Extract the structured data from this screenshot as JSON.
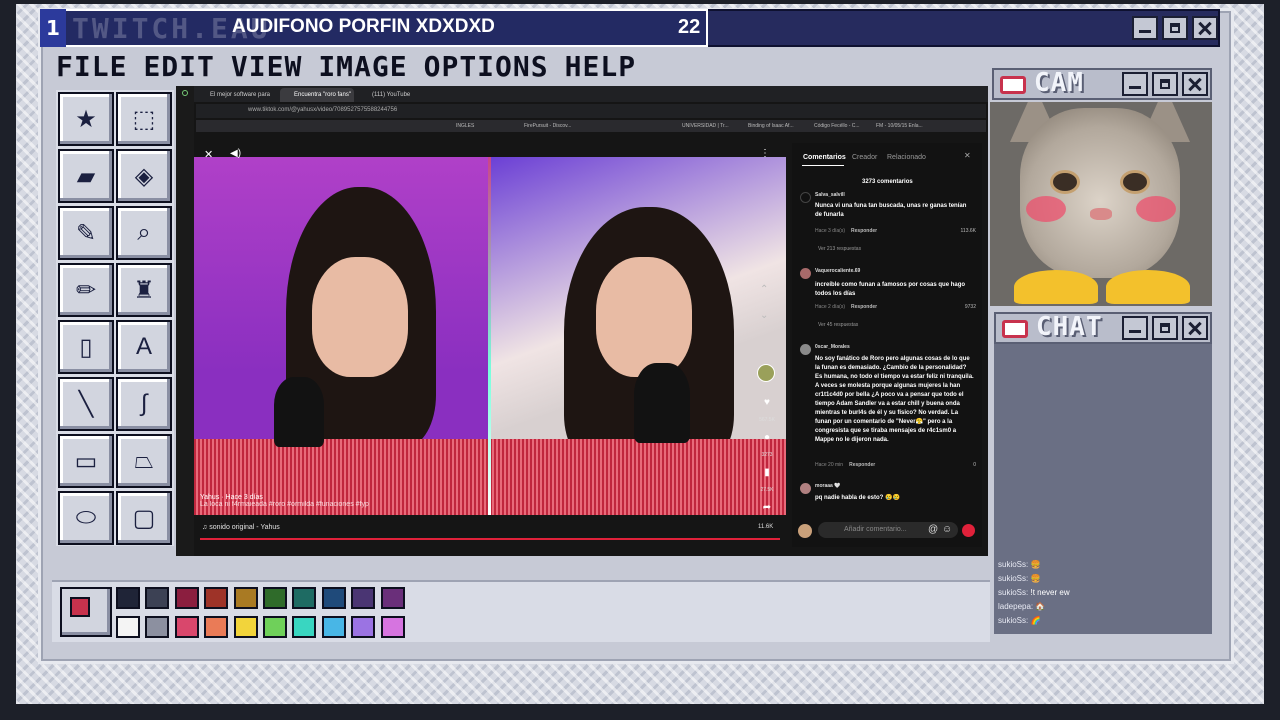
{
  "header": {
    "number": "1",
    "watermark": "TWITCH.EAU",
    "stream_title": "AUDIFONO PORFIN XDXDXD",
    "viewer_count": "22"
  },
  "menu": [
    "FILE",
    "EDIT",
    "VIEW",
    "IMAGE",
    "OPTIONS",
    "HELP"
  ],
  "browser": {
    "tabs": [
      "El mejor software para pro",
      "Encuentra \"roro fans\"",
      "(111) YouTube"
    ],
    "url": "www.tiktok.com/@yahusx/video/7089527575588244756",
    "bookmarks": [
      "INGLES",
      "FirePursuit - Discov...",
      "UNIVERSIDAD | Tr...",
      "Binding of Isaac Af...",
      "Código Fecéllo - C...",
      "FM - 10/05/15 Enla..."
    ],
    "video": {
      "caption_user": "Yahus · Hace 3 días",
      "caption_text": "La loca ni f4rmaieada  #roro #ormilda #funaciones #fyp",
      "sound": "sonido original - Yahus",
      "likes": "567.5K",
      "comments": "3273",
      "saves": "27.5K",
      "shares": "11.6K"
    },
    "comments_panel": {
      "tabs": [
        "Comentarios",
        "Creador",
        "Relacionado"
      ],
      "count": "3273 comentarios",
      "comments": [
        {
          "user": "Salva_salvill",
          "text": "Nunca vi una funa tan buscada, unas re ganas tenían de funarla",
          "meta": "Hace 3 día(s)",
          "reply": "Responder",
          "likes": "113.6K",
          "replies": "Ver 213 respuestas"
        },
        {
          "user": "Vaquerocaliente.69",
          "text": "increíble como funan a famosos por cosas que hago todos los días",
          "meta": "Hace 2 día(s)",
          "reply": "Responder",
          "likes": "9732",
          "replies": "Ver 45 respuestas"
        },
        {
          "user": "0scar_Morales",
          "text": "No soy fanático de Roro pero algunas cosas de lo que la funan es demasiado. ¿Cambio de la personalidad? Es humana, no todo el tiempo va estar feliz ni tranquila. A veces se molesta porque algunas mujeres la han cr1t1c4d0 por bella ¿A poco va a pensar que todo el tiempo Adam Sandler va a estar chill y buena onda mientras te burl4s de él y su físico? No verdad. La funan por un comentario de \"Never😤\" pero a la congresista que se tiraba mensajes de r4c1sm0 a Mappe no le dijeron nada.",
          "meta": "Hace 20 min",
          "reply": "Responder",
          "likes": "0",
          "replies": ""
        },
        {
          "user": "moraaa 🤍",
          "text": "pq nadie habla de esto? 😢😢",
          "meta": "",
          "reply": "",
          "likes": "",
          "replies": ""
        }
      ],
      "input_placeholder": "Añadir comentario..."
    }
  },
  "cam": {
    "title": "CAM"
  },
  "chat": {
    "title": "CHAT",
    "messages": [
      {
        "user": "sukioSs:",
        "text": "🍔"
      },
      {
        "user": "sukioSs:",
        "text": "🍔"
      },
      {
        "user": "sukioSs:",
        "text": "!t never ew"
      },
      {
        "user": "ladepepa:",
        "text": "🏠"
      },
      {
        "user": "sukioSs:",
        "text": "🌈"
      }
    ]
  },
  "palette": {
    "row1": [
      "#1f2437",
      "#3c4154",
      "#8b1e3f",
      "#9e3328",
      "#a97a23",
      "#2f6b2a",
      "#1e6b63",
      "#1f4a7a",
      "#4a3573",
      "#6a2f7a"
    ],
    "row2": [
      "#f4f4f4",
      "#8c90a0",
      "#d9476c",
      "#ea7b57",
      "#f2d43b",
      "#6fd05a",
      "#39d6c1",
      "#48b6e6",
      "#9b73e3",
      "#d674e0"
    ]
  },
  "icons": [
    "star-icon",
    "select-icon",
    "eraser-icon",
    "fill-icon",
    "eyedropper-icon",
    "zoom-icon",
    "pencil-icon",
    "brush-icon",
    "spray-icon",
    "text-icon",
    "line-icon",
    "curve-icon",
    "rectangle-icon",
    "polygon-icon",
    "ellipse-icon",
    "rounded-rect-icon"
  ]
}
